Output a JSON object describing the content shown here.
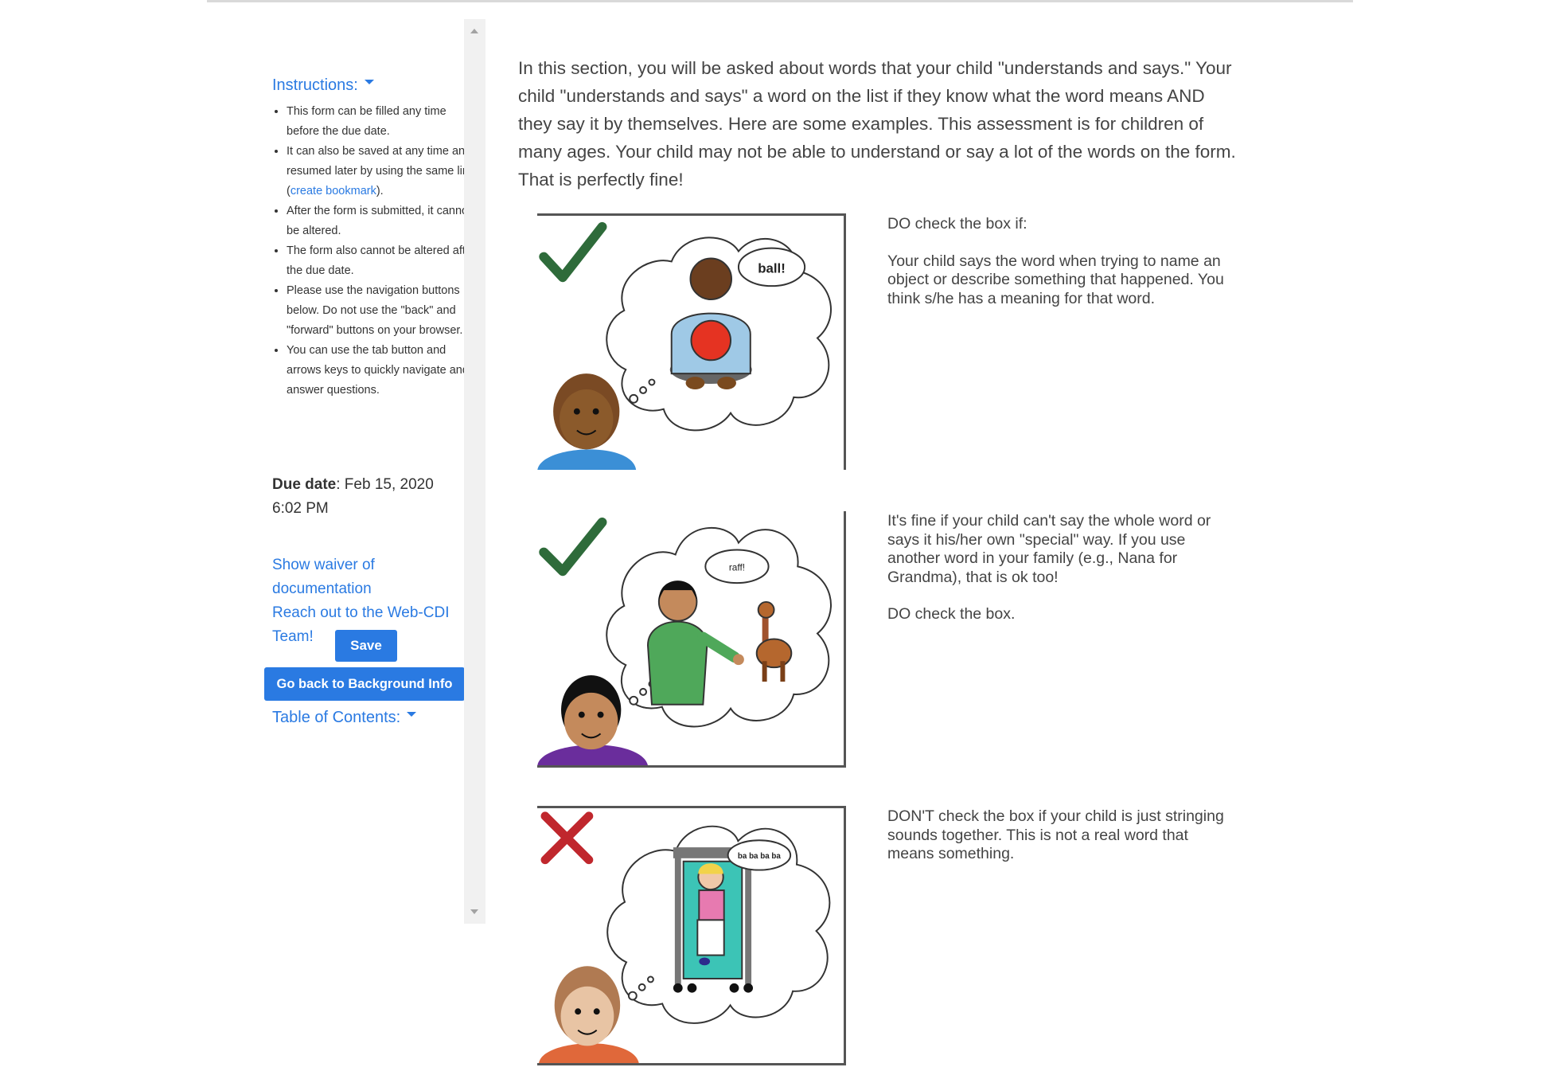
{
  "sidebar": {
    "instructions_label": "Instructions:",
    "instructions": {
      "i1": "This form can be filled any time before the due date.",
      "i2_before": "It can also be saved at any time and resumed later by using the same link (",
      "i2_link": "create bookmark",
      "i2_after": ").",
      "i3": "After the form is submitted, it cannot be altered.",
      "i4": "The form also cannot be altered after the due date.",
      "i5": "Please use the navigation buttons below. Do not use the \"back\" and \"forward\" buttons on your browser.",
      "i6": "You can use the tab button and arrows keys to quickly navigate and answer questions."
    },
    "due_label": "Due date",
    "due_value": ": Feb 15, 2020 6:02 PM",
    "waiver_link": "Show waiver of documentation",
    "contact_link": "Reach out to the Web-CDI Team!",
    "save_label": "Save",
    "back_label": "Go back to Background Info",
    "toc_label": "Table of Contents:"
  },
  "main": {
    "intro": "In this section, you will be asked about words that your child \"understands and says.\" Your child \"understands and says\" a word on the list if they know what the word means AND they say it by themselves. Here are some examples. This assessment is for children of many ages. Your child may not be able to understand or say a lot of the words on the form. That is perfectly fine!",
    "examples": [
      {
        "bubble": "ball!",
        "caption": [
          "DO check the box if:",
          "Your child says the word when trying to name an object or describe something that happened. You think s/he has a meaning for that word."
        ]
      },
      {
        "bubble": "raff!",
        "caption": [
          "It's fine if your child can't say the whole word or says it his/her own \"special\" way. If you use another word in your family (e.g., Nana for Grandma), that is ok too!",
          "DO check the box."
        ]
      },
      {
        "bubble": "ba ba ba ba",
        "caption": [
          "DON'T check the box if your child is just stringing sounds together. This is not a real word that means something."
        ]
      }
    ]
  },
  "colors": {
    "link": "#2a7ae2",
    "button": "#2a7ae2",
    "check_green": "#2e6b3a",
    "cross_red": "#c0272d"
  },
  "icons": [
    "checkmark-icon",
    "checkmark-icon",
    "cross-icon",
    "caret-down-icon",
    "scroll-up-arrow-icon",
    "scroll-down-arrow-icon"
  ]
}
